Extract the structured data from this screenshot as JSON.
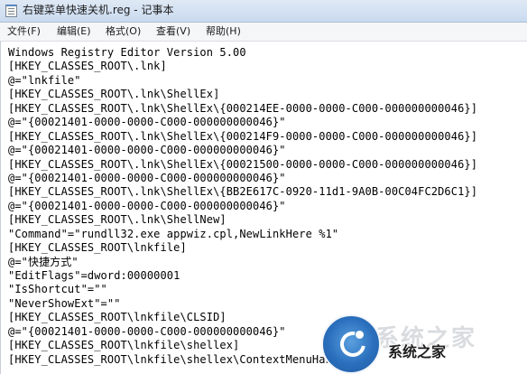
{
  "window": {
    "title": "右键菜单快速关机.reg - 记事本",
    "app_icon": "notepad-icon"
  },
  "menu": {
    "items": [
      "文件(F)",
      "编辑(E)",
      "格式(O)",
      "查看(V)",
      "帮助(H)"
    ]
  },
  "editor": {
    "lines": [
      "Windows Registry Editor Version 5.00",
      "[HKEY_CLASSES_ROOT\\.lnk]",
      "@=\"lnkfile\"",
      "[HKEY_CLASSES_ROOT\\.lnk\\ShellEx]",
      "[HKEY_CLASSES_ROOT\\.lnk\\ShellEx\\{000214EE-0000-0000-C000-000000000046}]",
      "@=\"{00021401-0000-0000-C000-000000000046}\"",
      "[HKEY_CLASSES_ROOT\\.lnk\\ShellEx\\{000214F9-0000-0000-C000-000000000046}]",
      "@=\"{00021401-0000-0000-C000-000000000046}\"",
      "[HKEY_CLASSES_ROOT\\.lnk\\ShellEx\\{00021500-0000-0000-C000-000000000046}]",
      "@=\"{00021401-0000-0000-C000-000000000046}\"",
      "[HKEY_CLASSES_ROOT\\.lnk\\ShellEx\\{BB2E617C-0920-11d1-9A0B-00C04FC2D6C1}]",
      "@=\"{00021401-0000-0000-C000-000000000046}\"",
      "[HKEY_CLASSES_ROOT\\.lnk\\ShellNew]",
      "\"Command\"=\"rundll32.exe appwiz.cpl,NewLinkHere %1\"",
      "[HKEY_CLASSES_ROOT\\lnkfile]",
      "@=\"快捷方式\"",
      "\"EditFlags\"=dword:00000001",
      "\"IsShortcut\"=\"\"",
      "\"NeverShowExt\"=\"\"",
      "[HKEY_CLASSES_ROOT\\lnkfile\\CLSID]",
      "@=\"{00021401-0000-0000-C000-000000000046}\"",
      "[HKEY_CLASSES_ROOT\\lnkfile\\shellex]",
      "[HKEY_CLASSES_ROOT\\lnkfile\\shellex\\ContextMenuHandlers]"
    ]
  },
  "watermark": {
    "text": "系统之家",
    "faded_text": "系统之家",
    "logo": "xitongzhijia-logo"
  }
}
